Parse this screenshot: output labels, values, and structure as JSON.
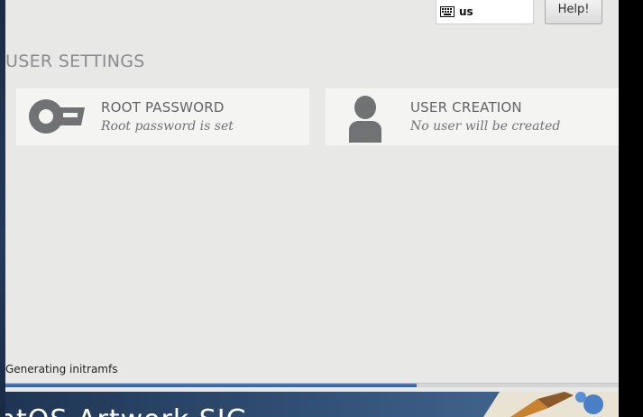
{
  "header": {
    "keyboard_icon": "keyboard-icon",
    "keyboard_layout": "us",
    "help_label": "Help!"
  },
  "section": {
    "title": "USER SETTINGS"
  },
  "spokes": [
    {
      "icon": "key-icon",
      "title": "ROOT PASSWORD",
      "status": "Root password is set"
    },
    {
      "icon": "user-icon",
      "title": "USER CREATION",
      "status": "No user will be created"
    }
  ],
  "progress": {
    "label": "Generating initramfs",
    "fraction": 0.67,
    "color": "#2b5ea8"
  },
  "banner": {
    "text": "ntOS Artwork SIG",
    "colors": [
      "#1f3553",
      "#4a6e96"
    ]
  }
}
